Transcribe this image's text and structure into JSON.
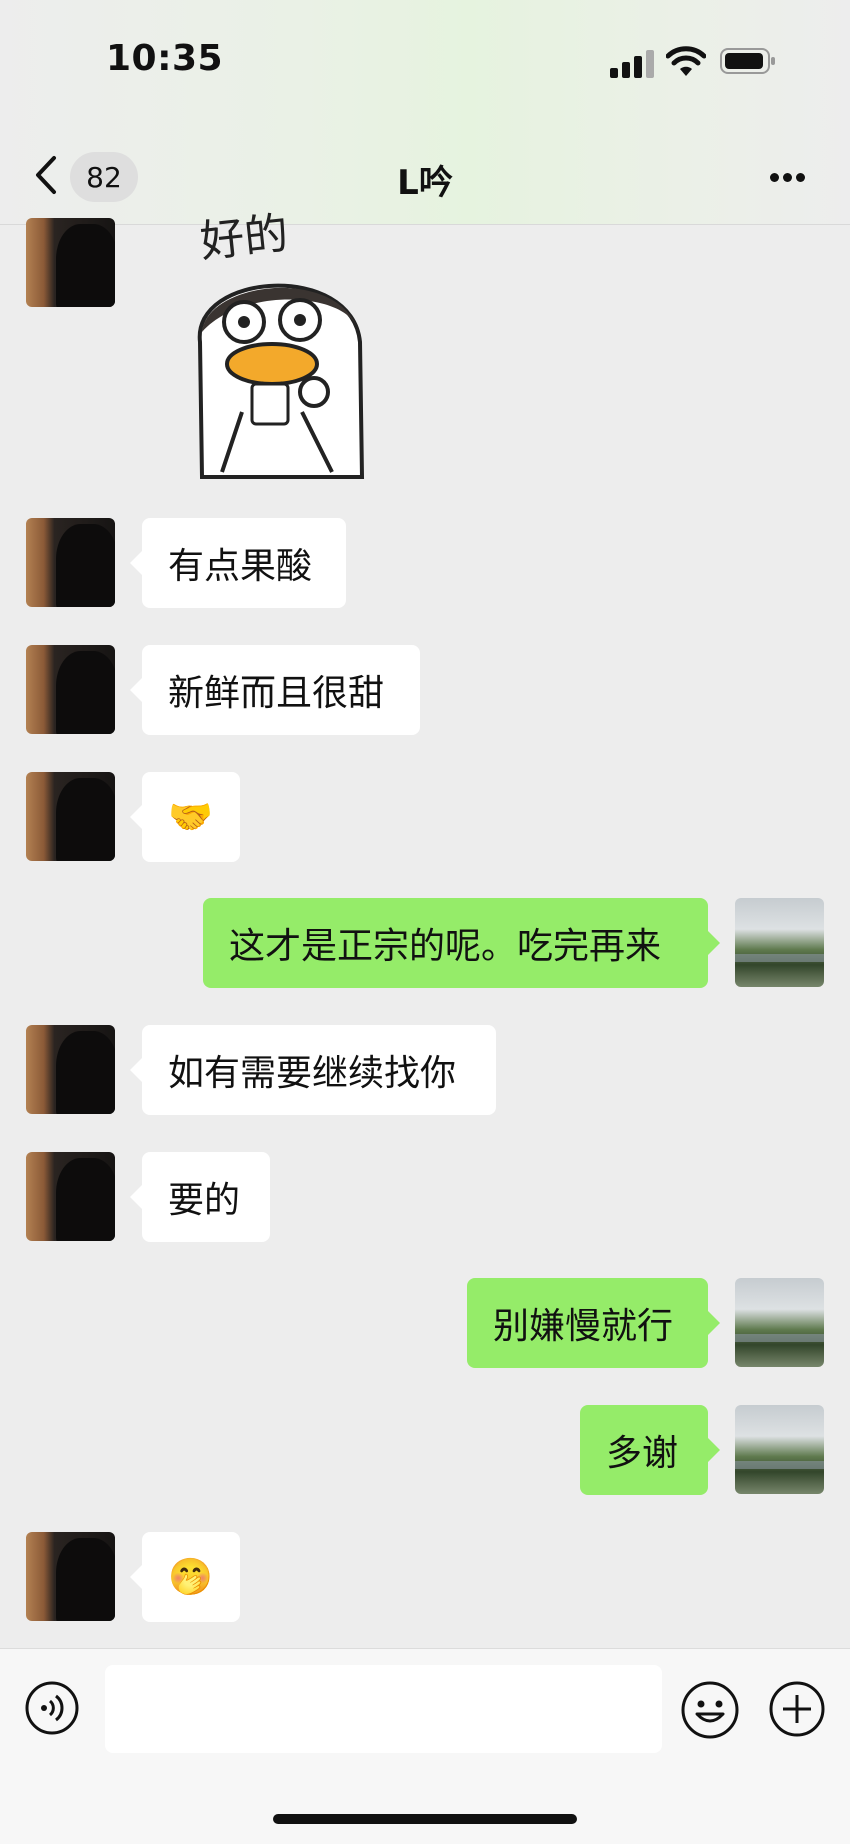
{
  "status_bar": {
    "time": "10:35"
  },
  "header": {
    "unread_count": "82",
    "title": "L吟"
  },
  "messages": [
    {
      "side": "in",
      "type": "sticker",
      "text": "好的"
    },
    {
      "side": "in",
      "type": "text",
      "text": "有点果酸"
    },
    {
      "side": "in",
      "type": "text",
      "text": "新鲜而且很甜"
    },
    {
      "side": "in",
      "type": "emoji",
      "text": "🤝"
    },
    {
      "side": "out",
      "type": "text",
      "text": "这才是正宗的呢。吃完再来"
    },
    {
      "side": "in",
      "type": "text",
      "text": "如有需要继续找你"
    },
    {
      "side": "in",
      "type": "text",
      "text": "要的"
    },
    {
      "side": "out",
      "type": "text",
      "text": "别嫌慢就行"
    },
    {
      "side": "out",
      "type": "text",
      "text": "多谢"
    },
    {
      "side": "in",
      "type": "emoji",
      "text": "🤭"
    }
  ],
  "input": {
    "value": ""
  },
  "colors": {
    "incoming_bubble": "#ffffff",
    "outgoing_bubble": "#95ec69",
    "background": "#ededed"
  }
}
